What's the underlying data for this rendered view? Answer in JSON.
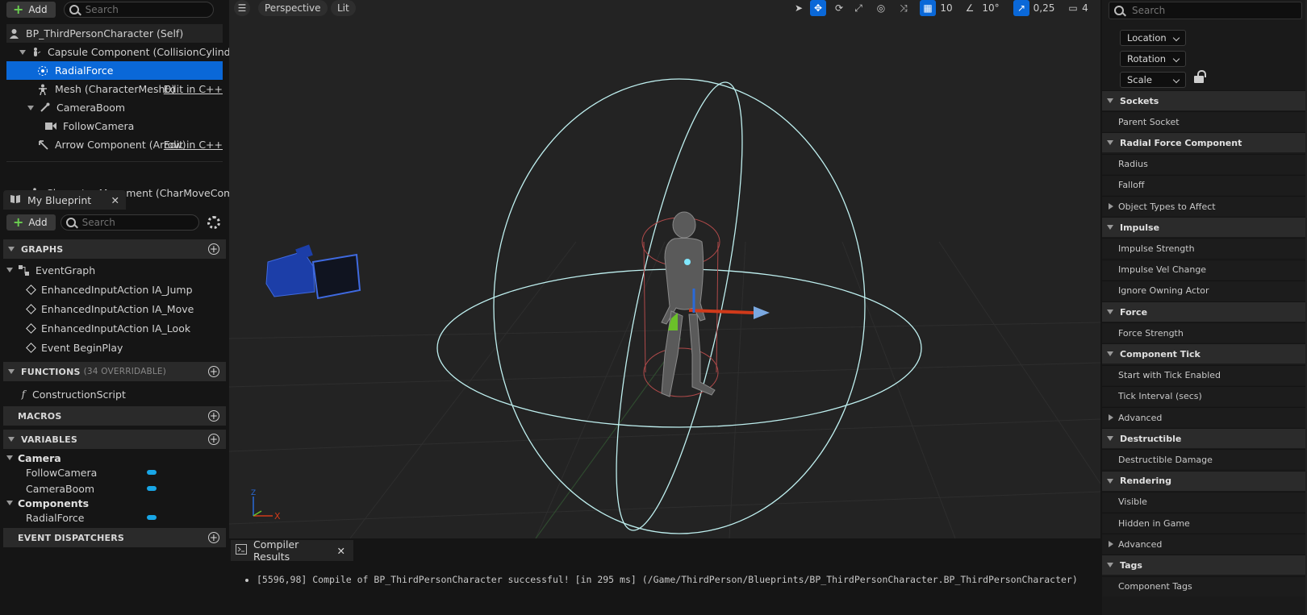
{
  "components_panel": {
    "add_label": "Add",
    "search_placeholder": "Search",
    "items": [
      {
        "label": "BP_ThirdPersonCharacter (Self)",
        "icon": "character-icon"
      },
      {
        "label": "Capsule Component (CollisionCylinder)",
        "icon": "capsule-icon"
      },
      {
        "label": "RadialForce",
        "icon": "radial-force-icon",
        "selected": true
      },
      {
        "label": "Mesh (CharacterMesh0)",
        "icon": "skeleton-icon",
        "edit": "Edit in C++"
      },
      {
        "label": "CameraBoom",
        "icon": "spring-arm-icon"
      },
      {
        "label": "FollowCamera",
        "icon": "camera-icon"
      },
      {
        "label": "Arrow Component (Arrow)",
        "icon": "arrow-icon",
        "edit": "Edit in C++"
      },
      {
        "label": "Character Movement (CharMoveComp)",
        "icon": "movement-icon"
      }
    ]
  },
  "my_blueprint": {
    "tab_label": "My Blueprint",
    "add_label": "Add",
    "search_placeholder": "Search",
    "sections": {
      "graphs": "GRAPHS",
      "functions": "FUNCTIONS",
      "functions_count": "(34 OVERRIDABLE)",
      "macros": "MACROS",
      "variables": "VARIABLES",
      "event_dispatchers": "EVENT DISPATCHERS"
    },
    "graphs": [
      "EventGraph",
      "EnhancedInputAction IA_Jump",
      "EnhancedInputAction IA_Move",
      "EnhancedInputAction IA_Look",
      "Event BeginPlay"
    ],
    "functions": [
      "ConstructionScript"
    ],
    "variable_categories": [
      {
        "name": "Camera",
        "vars": [
          "FollowCamera",
          "CameraBoom"
        ]
      },
      {
        "name": "Components",
        "vars": [
          "RadialForce"
        ]
      }
    ],
    "var_color": "#18a6e6"
  },
  "viewport": {
    "perspective": "Perspective",
    "lit": "Lit",
    "grid_snap": "10",
    "rot_snap": "10°",
    "scale_snap": "0,25",
    "cam_speed": "4",
    "axis": {
      "x": "X",
      "z": "Z"
    },
    "colors": {
      "sphere": "#bff0f0",
      "capsule": "#b04a4a",
      "x_axis": "#d03a1a",
      "y_axis": "#6bc02a",
      "z_axis": "#2a6ad8",
      "accent": "#0a68d8"
    }
  },
  "compiler": {
    "tab_label": "Compiler Results",
    "message": "[5596,98] Compile of BP_ThirdPersonCharacter successful! [in 295 ms] (/Game/ThirdPerson/Blueprints/BP_ThirdPersonCharacter.BP_ThirdPersonCharacter)"
  },
  "details": {
    "search_placeholder": "Search",
    "transform": [
      "Location",
      "Rotation",
      "Scale"
    ],
    "categories": [
      {
        "title": "Sockets",
        "rows": [
          {
            "label": "Parent Socket"
          }
        ]
      },
      {
        "title": "Radial Force Component",
        "rows": [
          {
            "label": "Radius"
          },
          {
            "label": "Falloff"
          },
          {
            "label": "Object Types to Affect",
            "expandable": true
          }
        ]
      },
      {
        "title": "Impulse",
        "rows": [
          {
            "label": "Impulse Strength"
          },
          {
            "label": "Impulse Vel Change"
          },
          {
            "label": "Ignore Owning Actor"
          }
        ]
      },
      {
        "title": "Force",
        "rows": [
          {
            "label": "Force Strength"
          }
        ]
      },
      {
        "title": "Component Tick",
        "rows": [
          {
            "label": "Start with Tick Enabled"
          },
          {
            "label": "Tick Interval (secs)"
          },
          {
            "label": "Advanced",
            "expandable": true
          }
        ]
      },
      {
        "title": "Destructible",
        "rows": [
          {
            "label": "Destructible Damage"
          }
        ]
      },
      {
        "title": "Rendering",
        "rows": [
          {
            "label": "Visible"
          },
          {
            "label": "Hidden in Game"
          },
          {
            "label": "Advanced",
            "expandable": true
          }
        ]
      },
      {
        "title": "Tags",
        "rows": [
          {
            "label": "Component Tags"
          }
        ]
      }
    ]
  }
}
